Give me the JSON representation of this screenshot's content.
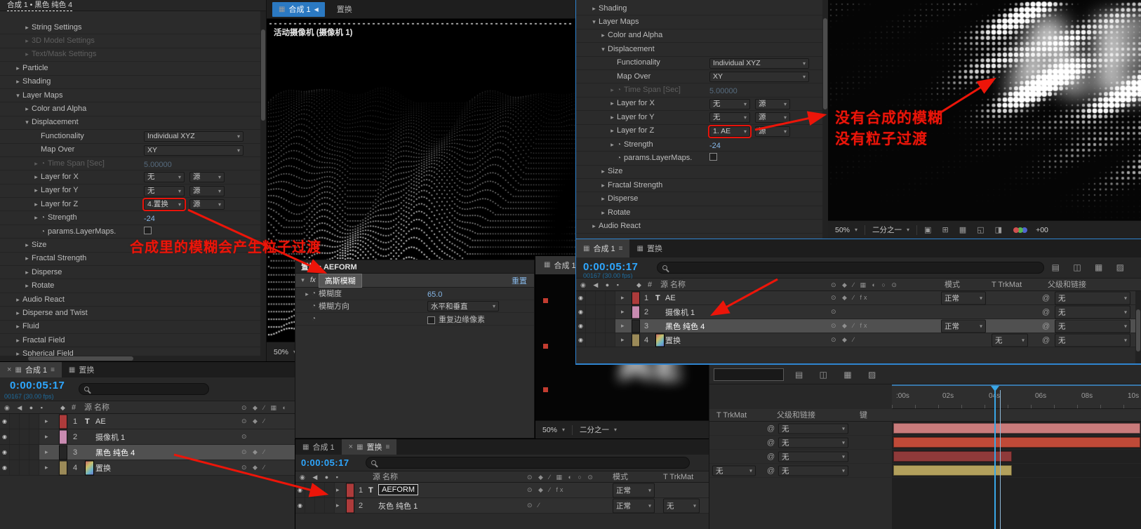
{
  "colors": {
    "accent_blue": "#2b79c2",
    "timecode_blue": "#2ea7ff",
    "annotation_red": "#ec1509",
    "value_blue": "#86b7e8"
  },
  "icons": {
    "panel": "▦",
    "menu": "≡",
    "close": "×",
    "chevron_down": "▾",
    "chevron_left": "◀",
    "twirl_closed": "▸",
    "twirl_open": "▾",
    "stopwatch": "◔",
    "eye": "◉",
    "pickwhip": "@",
    "tag": "◆",
    "hash": "#",
    "fx": "fx",
    "av_header_cluster": "◉ ◀ ● ▪",
    "switch_header_cluster": "⊙ ◆ ∕ ▦ ◐ ○ ⊙",
    "toolbar_cluster": "▤ ◫ ▦ ▨",
    "viewer_cluster": "▣ ⊞ ▦ ◱ ◨"
  },
  "annotations": {
    "mid_text": "合成里的模糊会产生粒子过渡",
    "right_text_line1": "没有合成的模糊",
    "right_text_line2": "没有粒子过渡"
  },
  "effects_left": {
    "tab_title": "合成 1 • 黑色 纯色 4",
    "rows": [
      {
        "label": "String Settings",
        "indent": 2,
        "tw": "c"
      },
      {
        "label": "3D Model Settings",
        "indent": 2,
        "tw": "c",
        "dim": true
      },
      {
        "label": "Text/Mask Settings",
        "indent": 2,
        "tw": "c",
        "dim": true
      },
      {
        "label": "Particle",
        "indent": 1,
        "tw": "c"
      },
      {
        "label": "Shading",
        "indent": 1,
        "tw": "c"
      },
      {
        "label": "Layer Maps",
        "indent": 1,
        "tw": "o"
      },
      {
        "label": "Color and Alpha",
        "indent": 2,
        "tw": "c"
      },
      {
        "label": "Displacement",
        "indent": 2,
        "tw": "o"
      },
      {
        "label": "Functionality",
        "indent": 3,
        "ctrl": {
          "type": "select",
          "value": "Individual XYZ"
        }
      },
      {
        "label": "Map Over",
        "indent": 3,
        "ctrl": {
          "type": "select",
          "value": "XY"
        }
      },
      {
        "label": "Time Span [Sec]",
        "indent": 3,
        "tw": "c",
        "sw": true,
        "dim": true,
        "ctrl": {
          "type": "dimtext",
          "value": "5.00000"
        }
      },
      {
        "label": "Layer for X",
        "indent": 3,
        "tw": "c",
        "ctrl": {
          "type": "select2",
          "value": "无",
          "value2": "源"
        }
      },
      {
        "label": "Layer for Y",
        "indent": 3,
        "tw": "c",
        "ctrl": {
          "type": "select2",
          "value": "无",
          "value2": "源"
        }
      },
      {
        "label": "Layer for Z",
        "indent": 3,
        "tw": "c",
        "ctrl": {
          "type": "select2",
          "value": "4.置换",
          "value2": "源",
          "red": true
        }
      },
      {
        "label": "Strength",
        "indent": 3,
        "tw": "c",
        "sw": true,
        "ctrl": {
          "type": "value",
          "value": "-24"
        }
      },
      {
        "label": "params.LayerMaps.",
        "indent": 3,
        "sw": true,
        "ctrl": {
          "type": "check"
        }
      },
      {
        "label": "Size",
        "indent": 2,
        "tw": "c"
      },
      {
        "label": "Fractal Strength",
        "indent": 2,
        "tw": "c"
      },
      {
        "label": "Disperse",
        "indent": 2,
        "tw": "c"
      },
      {
        "label": "Rotate",
        "indent": 2,
        "tw": "c"
      },
      {
        "label": "Audio React",
        "indent": 1,
        "tw": "c"
      },
      {
        "label": "Disperse and Twist",
        "indent": 1,
        "tw": "c"
      },
      {
        "label": "Fluid",
        "indent": 1,
        "tw": "c"
      },
      {
        "label": "Fractal Field",
        "indent": 1,
        "tw": "c"
      },
      {
        "label": "Spherical Field",
        "indent": 1,
        "tw": "c"
      }
    ]
  },
  "effects_right": {
    "rows": [
      {
        "label": "Shading",
        "indent": 1,
        "tw": "c"
      },
      {
        "label": "Layer Maps",
        "indent": 1,
        "tw": "o"
      },
      {
        "label": "Color and Alpha",
        "indent": 2,
        "tw": "c"
      },
      {
        "label": "Displacement",
        "indent": 2,
        "tw": "o"
      },
      {
        "label": "Functionality",
        "indent": 3,
        "ctrl": {
          "type": "select",
          "value": "Individual XYZ"
        }
      },
      {
        "label": "Map Over",
        "indent": 3,
        "ctrl": {
          "type": "select",
          "value": "XY"
        }
      },
      {
        "label": "Time Span [Sec]",
        "indent": 3,
        "tw": "c",
        "sw": true,
        "dim": true,
        "ctrl": {
          "type": "dimtext",
          "value": "5.00000"
        }
      },
      {
        "label": "Layer for X",
        "indent": 3,
        "tw": "c",
        "ctrl": {
          "type": "select2",
          "value": "无",
          "value2": "源"
        }
      },
      {
        "label": "Layer for Y",
        "indent": 3,
        "tw": "c",
        "ctrl": {
          "type": "select2",
          "value": "无",
          "value2": "源"
        }
      },
      {
        "label": "Layer for Z",
        "indent": 3,
        "tw": "c",
        "ctrl": {
          "type": "select2",
          "value": "1. AE",
          "value2": "源",
          "red": true
        }
      },
      {
        "label": "Strength",
        "indent": 3,
        "tw": "c",
        "sw": true,
        "ctrl": {
          "type": "value",
          "value": "-24"
        }
      },
      {
        "label": "params.LayerMaps.",
        "indent": 3,
        "sw": true,
        "ctrl": {
          "type": "check"
        }
      },
      {
        "label": "Size",
        "indent": 2,
        "tw": "c"
      },
      {
        "label": "Fractal Strength",
        "indent": 2,
        "tw": "c"
      },
      {
        "label": "Disperse",
        "indent": 2,
        "tw": "c"
      },
      {
        "label": "Rotate",
        "indent": 2,
        "tw": "c"
      },
      {
        "label": "Audio React",
        "indent": 1,
        "tw": "c"
      }
    ]
  },
  "viewer_main": {
    "tab_comp": "合成 1",
    "tab_disp": "置换",
    "camera_label": "活动摄像机 (摄像机 1)",
    "zoom": "50%"
  },
  "viewer_right": {
    "zoom": "50%",
    "resolution": "二分之一",
    "exposure": "+00"
  },
  "viewer_small": {
    "tab": "合成 1",
    "zoom": "50%",
    "resolution": "二分之一"
  },
  "blur_panel": {
    "tab_title": "置换 • AEFORM",
    "effect_name": "高斯模糊",
    "reset_label": "重置",
    "blurriness_label": "模糊度",
    "blurriness_value": "65.0",
    "direction_label": "模糊方向",
    "direction_value": "水平和垂直",
    "repeat_edge_label": "重复边缘像素"
  },
  "timeline_e": {
    "tab_comp": "合成 1",
    "tab_disp": "置换",
    "time": "0:00:05:17",
    "frame_info": "00167 (30.00 fps)",
    "col_source": "源 名称",
    "col_mode": "模式",
    "col_trkmat": "T TrkMat",
    "col_parent": "父级和链接",
    "rows": [
      {
        "num": "1",
        "color": "#ad3b3b",
        "type": "T",
        "name": "AE",
        "switches": "⊙ ◆ ∕ fx",
        "mode": "正常",
        "parent": "无"
      },
      {
        "num": "2",
        "color": "#c98bb1",
        "name": "摄像机 1",
        "switches": "⊙",
        "parent": "无"
      },
      {
        "num": "3",
        "color": "#262626",
        "name": "黑色 纯色 4",
        "switches": "⊙ ◆ ∕ fx",
        "mode": "正常",
        "parent": "无",
        "selected": true
      },
      {
        "num": "4",
        "color": "#9b8a58",
        "name": "置换",
        "comp_icon": true,
        "switches": "⊙ ◆ ∕",
        "trkmat": "无",
        "parent": "无"
      }
    ]
  },
  "timeline_f": {
    "tab_comp": "合成 1",
    "tab_disp": "置换",
    "time": "0:00:05:17",
    "frame_info": "00167 (30.00 fps)",
    "col_source": "源 名称",
    "rows": [
      {
        "num": "1",
        "color": "#ad3b3b",
        "type": "T",
        "name": "AE",
        "switches": "⊙ ◆ ∕"
      },
      {
        "num": "2",
        "color": "#c98bb1",
        "name": "摄像机 1",
        "switches": "⊙"
      },
      {
        "num": "3",
        "color": "#262626",
        "name": "黑色 纯色 4",
        "switches": "⊙ ◆ ∕",
        "selected": true
      },
      {
        "num": "4",
        "color": "#9b8a58",
        "name": "置换",
        "comp_icon": true,
        "switches": "⊙ ◆ ∕"
      }
    ]
  },
  "timeline_i": {
    "tab_comp": "合成 1",
    "tab_disp": "置换",
    "time": "0:00:05:17",
    "col_source": "源 名称",
    "col_mode": "模式",
    "col_trkmat": "T TrkMat",
    "rows": [
      {
        "num": "1",
        "color": "#ad3b3b",
        "type": "T",
        "name": "AEFORM",
        "editing": true,
        "switches": "⊙ ◆ ∕ fx",
        "mode": "正常"
      },
      {
        "num": "2",
        "color": "#ad3b3b",
        "name": "灰色 纯色 1",
        "switches": "⊙ ∕",
        "mode": "正常",
        "trkmat": "无"
      }
    ]
  },
  "timeline_j": {
    "col_trkmat": "T TrkMat",
    "col_parent": "父级和链接",
    "col_key": "键",
    "ruler": [
      ":00s",
      "02s",
      "04s",
      "06s",
      "08s",
      "10s"
    ],
    "rows": [
      {
        "parent": "无",
        "bar_color": "#c97b7b",
        "bar_end": 1.0
      },
      {
        "parent": "无",
        "bar_color": "#c04a38",
        "bar_end": 1.0
      },
      {
        "parent": "无",
        "bar_color": "#8f3a3a",
        "bar_end": 0.48
      },
      {
        "trkmat": "无",
        "parent": "无",
        "bar_color": "#b2a05c",
        "bar_end": 0.48
      }
    ]
  }
}
